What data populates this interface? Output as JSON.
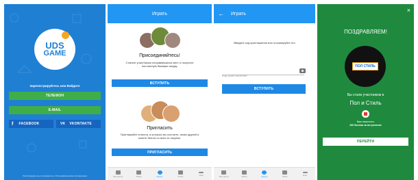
{
  "screen1": {
    "logo_line1": "UDS",
    "logo_line2": "GAME",
    "register_prompt": "Зарегистрируйтесь или Войдите",
    "phone_button": "ТЕЛЕФОН",
    "email_button": "E-MAIL",
    "facebook_button": "FACEBOOK",
    "vk_button": "VKONTAKTE",
    "footer_text": "Регистрируясь вы соглашаетесь с Пользовательским соглашением"
  },
  "screen2": {
    "title": "Играть",
    "join_heading": "Присоединяйтесь!",
    "join_text": "Станьте участником понравившихся мест и получите постоянную базовую скидку.",
    "join_button": "ВСТУПИТЬ",
    "invite_heading": "Пригласить",
    "invite_text": "Приглашайте в места, в которых вы состоите, своих друзей и копите баллы со всех их покупок.",
    "invite_button": "ПРИГЛАСИТЬ"
  },
  "screen3": {
    "title": "Играть",
    "instruction": "Введите код приглашения или отсканируйте его",
    "code_placeholder": "Код приглашения",
    "join_button": "ВСТУПИТЬ"
  },
  "screen4": {
    "close": "×",
    "congrats": "ПОЗДРАВЛЯЕМ!",
    "brand_logo": "ПОЛ СТИЛЬ",
    "became_member": "Вы стали участником в",
    "place_name": "Пол и Стиль",
    "credited_line1": "Вам начислено",
    "credited_line2": "200 баллов за вступление",
    "go_button": "ПЕРЕЙТИ"
  },
  "tabbar": {
    "tabs": [
      "Мои места",
      "Обзор",
      "Играть",
      "Поиск",
      "Ещё"
    ]
  },
  "colors": {
    "primary_blue": "#2196f3",
    "background_blue": "#1f7fd3",
    "green": "#3fae49",
    "success_green": "#1f8a3e"
  }
}
